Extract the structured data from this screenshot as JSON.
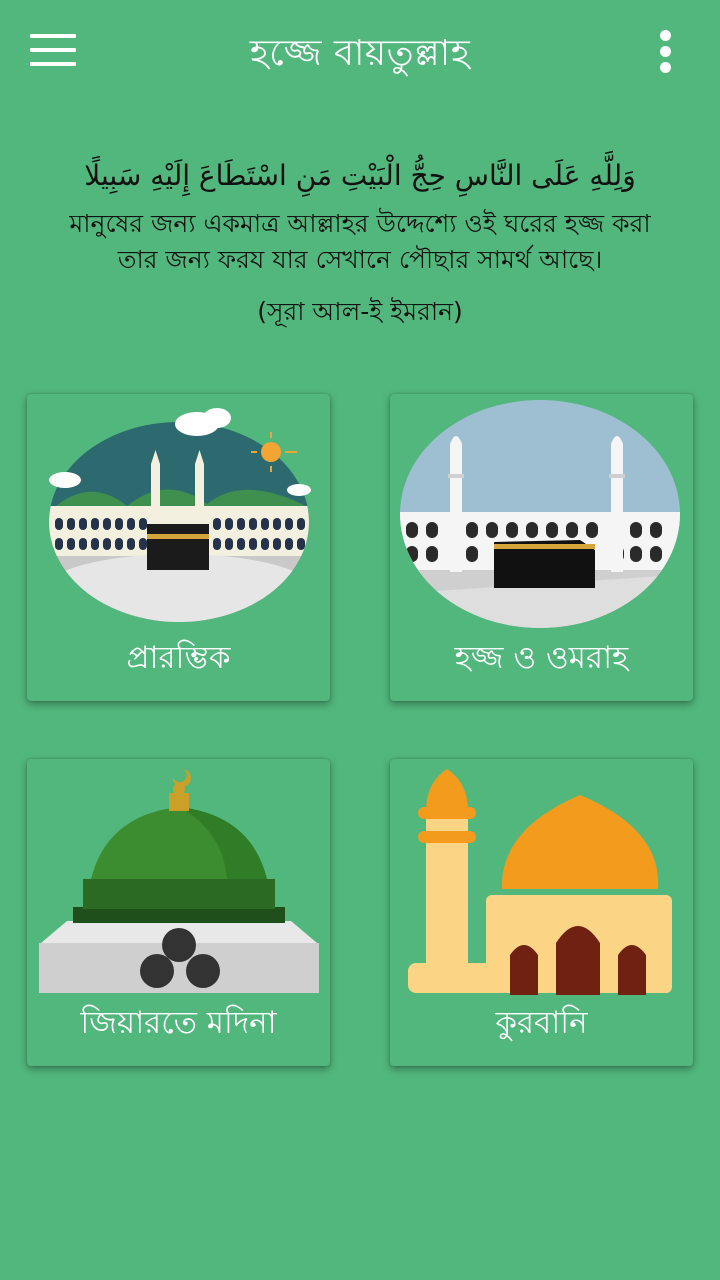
{
  "appbar": {
    "title": "হজ্জে বায়তুল্লাহ",
    "menu_icon": "hamburger-menu-icon",
    "more_icon": "more-vertical-icon"
  },
  "verse": {
    "arabic": "وَلِلَّهِ عَلَى النَّاسِ حِجُّ الْبَيْتِ مَنِ اسْتَطَاعَ إِلَيْهِ سَبِيلًا",
    "translation": "মানুষের জন্য একমাত্র আল্লাহর উদ্দেশ্যে ওই ঘরের হজ্জ করা তার জন্য ফরয যার সেখানে পৌছার সামর্থ আছে।",
    "reference": "(সূরা আল-ই ইমরান)"
  },
  "cards": [
    {
      "label": "প্রারম্ভিক",
      "icon": "kaaba-landscape-icon"
    },
    {
      "label": "হজ্জ ও ওমরাহ",
      "icon": "kaaba-mosque-icon"
    },
    {
      "label": "জিয়ারতে মদিনা",
      "icon": "green-dome-icon"
    },
    {
      "label": "কুরবানি",
      "icon": "mosque-icon"
    }
  ],
  "colors": {
    "background": "#52b77c",
    "text_light": "#ffffff"
  }
}
